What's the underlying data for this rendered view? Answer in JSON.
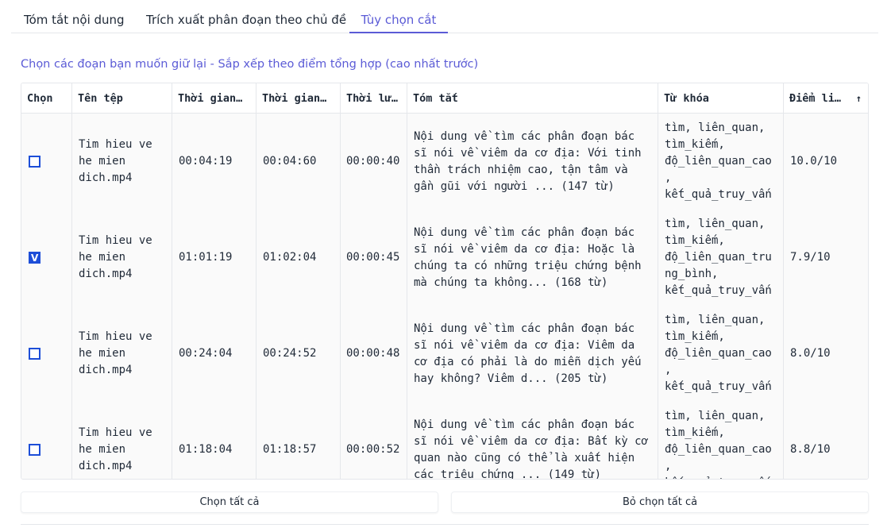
{
  "tabs": [
    {
      "label": "Tóm tắt nội dung"
    },
    {
      "label": "Trích xuất phân đoạn theo chủ đề"
    },
    {
      "label": "Tùy chọn cắt"
    }
  ],
  "caption": "Chọn các đoạn bạn muốn giữ lại - Sắp xếp theo điểm tổng hợp (cao nhất trước)",
  "table": {
    "headers": [
      "Chọn",
      "Tên tệp",
      "Thời gian…",
      "Thời gian…",
      "Thời lư…",
      "Tóm tắt",
      "Từ khóa",
      "Điểm li…"
    ],
    "sort_icon": "arrow-up-icon",
    "rows": [
      {
        "checked": false,
        "file": "Tim hieu ve\nhe mien\ndich.mp4",
        "start": "00:04:19",
        "end": "00:04:60",
        "duration": "00:00:40",
        "summary": "Nội dung về tìm các phân đoạn bác\nsĩ nói về viêm da cơ địa: Với tinh\nthần trách nhiệm cao, tận tâm và\ngần gũi với người ... (147 từ)",
        "keywords": "tìm, liên_quan,\ntìm_kiếm,\nđộ_liên_quan_cao\n,\nkết_quả_truy_vấn",
        "score": "10.0/10"
      },
      {
        "checked": true,
        "file": "Tim hieu ve\nhe mien\ndich.mp4",
        "start": "01:01:19",
        "end": "01:02:04",
        "duration": "00:00:45",
        "summary": "Nội dung về tìm các phân đoạn bác\nsĩ nói về viêm da cơ địa: Hoặc là\nchúng ta có những triệu chứng bệnh\nmà chúng ta không... (168 từ)",
        "keywords": "tìm, liên_quan,\ntìm_kiếm,\nđộ_liên_quan_tru\nng_bình,\nkết_quả_truy_vấn",
        "score": "7.9/10"
      },
      {
        "checked": false,
        "file": "Tim hieu ve\nhe mien\ndich.mp4",
        "start": "00:24:04",
        "end": "00:24:52",
        "duration": "00:00:48",
        "summary": "Nội dung về tìm các phân đoạn bác\nsĩ nói về viêm da cơ địa: Viêm da\ncơ địa có phải là do miễn dịch yếu\nhay không? Viêm d... (205 từ)",
        "keywords": "tìm, liên_quan,\ntìm_kiếm,\nđộ_liên_quan_cao\n,\nkết_quả_truy_vấn",
        "score": "8.0/10"
      },
      {
        "checked": false,
        "file": "Tim hieu ve\nhe mien\ndich.mp4",
        "start": "01:18:04",
        "end": "01:18:57",
        "duration": "00:00:52",
        "summary": "Nội dung về tìm các phân đoạn bác\nsĩ nói về viêm da cơ địa: Bất kỳ cơ\nquan nào cũng có thể là xuất hiện\ncác triệu chứng ... (149 từ)",
        "keywords": "tìm, liên_quan,\ntìm_kiếm,\nđộ_liên_quan_cao\n,\nkết_quả_truy_vấn",
        "score": "8.8/10"
      }
    ]
  },
  "buttons": {
    "select_all": "Chọn tất cả",
    "deselect_all": "Bỏ chọn tất cả"
  },
  "colors": {
    "accent": "#5b5bd6",
    "checkbox": "#1d4ed8"
  }
}
